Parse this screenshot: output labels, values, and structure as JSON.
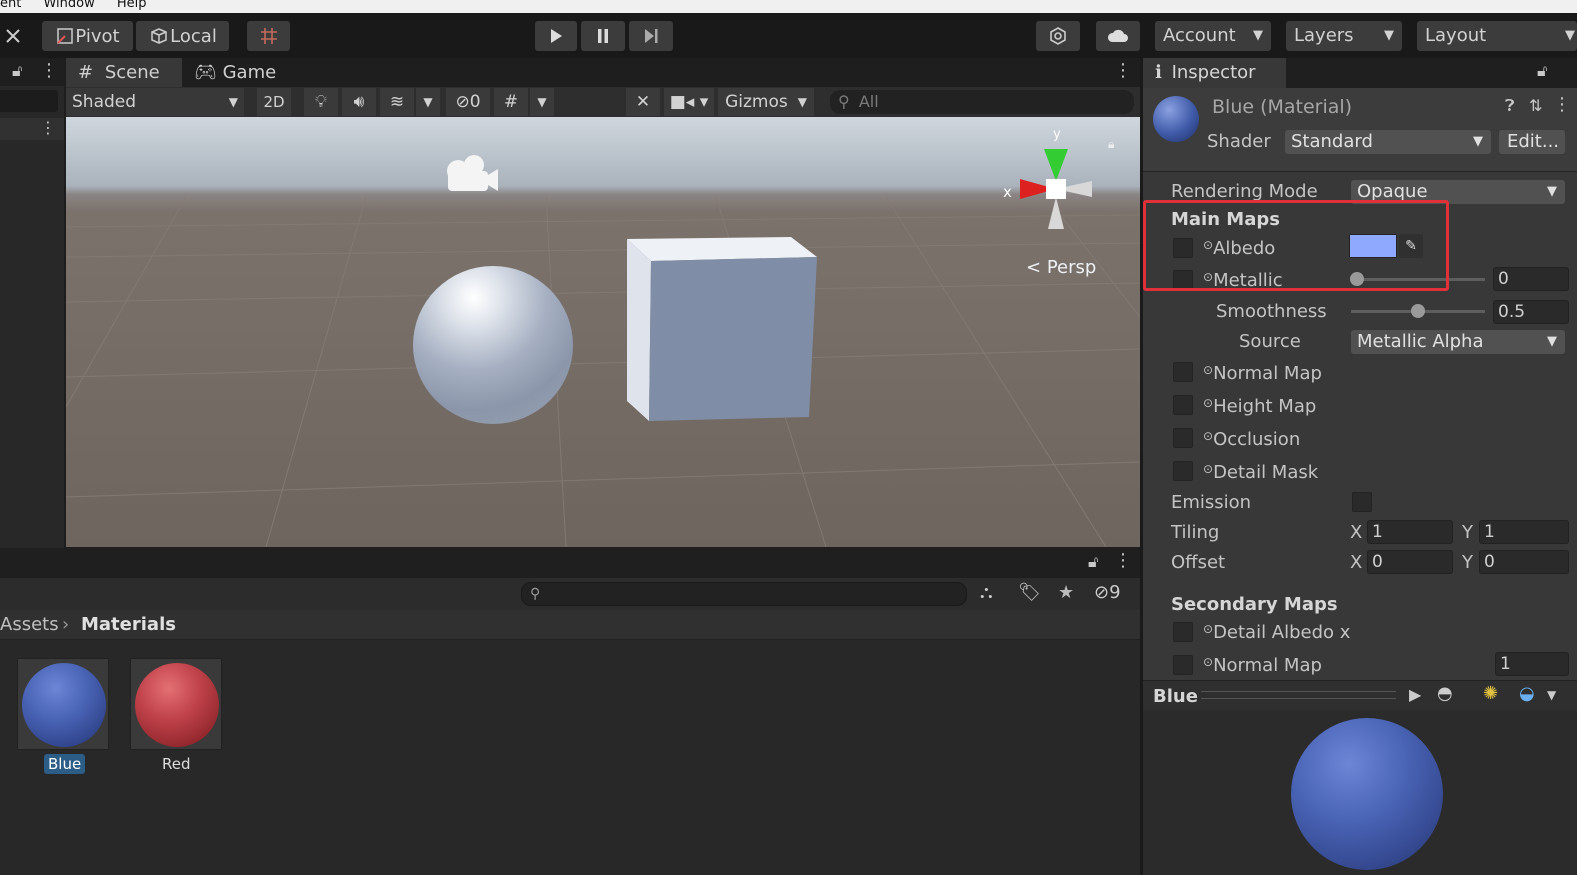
{
  "menubar": {
    "items": [
      "ent",
      "Window",
      "Help"
    ]
  },
  "toolbar": {
    "pivot": "Pivot",
    "local": "Local",
    "account": "Account",
    "layers": "Layers",
    "layout": "Layout"
  },
  "scene_tabs": {
    "scene": "Scene",
    "game": "Game"
  },
  "scene_toolbar": {
    "shading": "Shaded",
    "mode2d": "2D",
    "hidden_count": "0",
    "gizmos": "Gizmos",
    "search_placeholder": "All"
  },
  "viewport": {
    "persp_label": "Persp",
    "axis_x": "x",
    "axis_y": "y"
  },
  "inspector": {
    "tab": "Inspector",
    "material_name": "Blue (Material)",
    "shader_label": "Shader",
    "shader_value": "Standard",
    "edit_button": "Edit...",
    "rendering_mode_label": "Rendering Mode",
    "rendering_mode_value": "Opaque",
    "main_maps_header": "Main Maps",
    "albedo": "Albedo",
    "albedo_color": "#8ea9ff",
    "metallic": "Metallic",
    "metallic_value": "0",
    "smoothness": "Smoothness",
    "smoothness_value": "0.5",
    "source_label": "Source",
    "source_value": "Metallic Alpha",
    "normal_map": "Normal Map",
    "height_map": "Height Map",
    "occlusion": "Occlusion",
    "detail_mask": "Detail Mask",
    "emission": "Emission",
    "tiling": "Tiling",
    "tiling_x": "1",
    "tiling_y": "1",
    "offset": "Offset",
    "offset_x": "0",
    "offset_y": "0",
    "x_label": "X",
    "y_label": "Y",
    "secondary_maps_header": "Secondary Maps",
    "detail_albedo": "Detail Albedo x",
    "secondary_normal_map": "Normal Map",
    "secondary_normal_value": "1",
    "preview_title": "Blue"
  },
  "project": {
    "hidden_count": "9",
    "breadcrumb_root": "Assets",
    "breadcrumb_current": "Materials",
    "assets": [
      {
        "name": "Blue",
        "color": "#3f5aa8"
      },
      {
        "name": "Red",
        "color": "#b33a3f"
      }
    ]
  },
  "colors": {
    "highlight_box": "#e0303a",
    "selection": "#2c5d87"
  }
}
